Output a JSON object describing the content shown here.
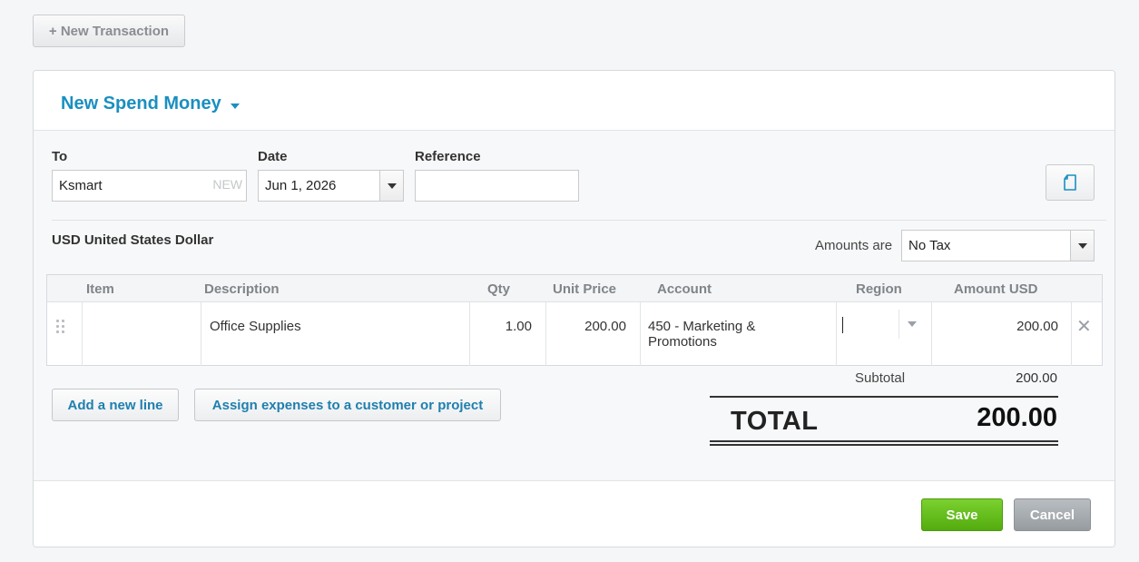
{
  "toolbar": {
    "new_transaction_label": "+ New Transaction"
  },
  "form": {
    "title": "New Spend Money",
    "to": {
      "label": "To",
      "value": "Ksmart",
      "new_tag": "NEW"
    },
    "date": {
      "label": "Date",
      "value": "Jun 1, 2026"
    },
    "reference": {
      "label": "Reference",
      "value": ""
    },
    "currency": "USD United States Dollar",
    "amounts_are": {
      "label": "Amounts are",
      "value": "No Tax"
    }
  },
  "table": {
    "headers": {
      "item": "Item",
      "description": "Description",
      "qty": "Qty",
      "unit_price": "Unit Price",
      "account": "Account",
      "region": "Region",
      "amount": "Amount USD"
    },
    "rows": [
      {
        "item": "",
        "description": "Office Supplies",
        "qty": "1.00",
        "unit_price": "200.00",
        "account_line1": "450 - Marketing &",
        "account_line2": "Promotions",
        "region": "",
        "amount": "200.00"
      }
    ]
  },
  "actions": {
    "add_line": "Add a new line",
    "assign_expenses": "Assign expenses to a customer or project"
  },
  "totals": {
    "subtotal_label": "Subtotal",
    "subtotal_value": "200.00",
    "total_label": "TOTAL",
    "total_value": "200.00"
  },
  "footer": {
    "save_label": "Save",
    "cancel_label": "Cancel"
  },
  "colors": {
    "accent": "#1a8fc0",
    "save_green": "#5cb516",
    "cancel_grey": "#a3a8ad"
  }
}
